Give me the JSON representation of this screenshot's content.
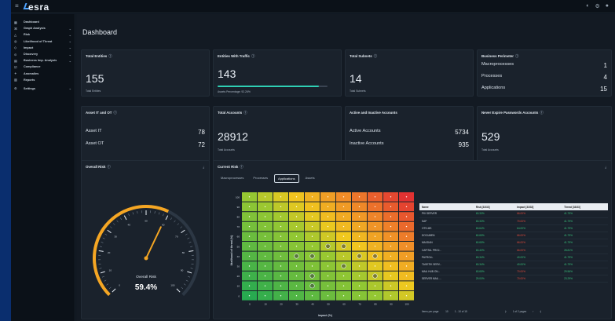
{
  "app": {
    "logo": "esra",
    "menu_icon": "menu-icon",
    "top_icons": [
      "notification-icon",
      "settings-icon",
      "user-icon"
    ]
  },
  "sidebar": {
    "items": [
      {
        "label": "Dashboard",
        "icon": "dashboard-icon",
        "chev": false
      },
      {
        "label": "Graph Analysis",
        "icon": "graph-icon",
        "chev": true
      },
      {
        "label": "Risk",
        "icon": "risk-icon",
        "chev": true
      },
      {
        "label": "Likelihood of Threat",
        "icon": "threat-icon",
        "chev": true
      },
      {
        "label": "Impact",
        "icon": "impact-icon",
        "chev": true
      },
      {
        "label": "Discovery",
        "icon": "discovery-icon",
        "chev": true
      },
      {
        "label": "Business Imp. Analysis",
        "icon": "business-icon",
        "chev": true
      },
      {
        "label": "Compliance",
        "icon": "compliance-icon",
        "chev": false
      },
      {
        "label": "Anomalies",
        "icon": "anomalies-icon",
        "chev": false
      },
      {
        "label": "Reports",
        "icon": "reports-icon",
        "chev": false
      },
      {
        "label": "Settings",
        "icon": "settings-icon",
        "chev": true
      }
    ]
  },
  "page_title": "Dashboard",
  "cards": {
    "total_entities": {
      "title": "Total Entities",
      "value": "155",
      "sub": "Total Entities"
    },
    "entities_traffic": {
      "title": "Entities With Traffic",
      "value": "143",
      "sub": "Assets Percentage: 92.26%",
      "progress": 0.9226
    },
    "total_subnets": {
      "title": "Total Subnets",
      "value": "14",
      "sub": "Total Subnets"
    },
    "business_perimeter": {
      "title": "Business Perimeter",
      "rows": [
        {
          "label": "Macroprocesses",
          "value": "1"
        },
        {
          "label": "Processes",
          "value": "4"
        },
        {
          "label": "Applications",
          "value": "15"
        }
      ]
    },
    "asset_it_ot": {
      "title": "Asset IT and OT",
      "rows": [
        {
          "label": "Asset IT",
          "value": "78"
        },
        {
          "label": "Asset OT",
          "value": "72"
        }
      ]
    },
    "total_accounts": {
      "title": "Total Accounts",
      "value": "28912",
      "sub": "Total Accounts"
    },
    "active_inactive": {
      "title": "Active and Inactive Accounts",
      "rows": [
        {
          "label": "Active Accounts",
          "value": "5734"
        },
        {
          "label": "Inactive Accounts",
          "value": "935"
        }
      ]
    },
    "never_expire": {
      "title": "Never Expire Passwords Accounts",
      "value": "529",
      "sub": "Total Accounts"
    }
  },
  "overall_risk": {
    "title": "Overall Risk",
    "label": "Overall Risk",
    "value": "59.4%",
    "level": 0.594,
    "ticks": [
      "0",
      "10",
      "20",
      "30",
      "40",
      "50",
      "60",
      "70",
      "80",
      "90",
      "100"
    ]
  },
  "current_risk": {
    "title": "Current Risk",
    "tabs": [
      "Macroprocesses",
      "Processes",
      "Applications",
      "Assets"
    ],
    "active_tab": "Applications",
    "ylabel": "likelihood of threat (%)",
    "xlabel": "impact (%)",
    "axis_ticks": [
      "0",
      "10",
      "20",
      "30",
      "40",
      "50",
      "60",
      "70",
      "80",
      "90",
      "100"
    ],
    "table": {
      "headers": [
        "Name",
        "Risk [33/33]",
        "Impact [33/33]",
        "Threat [33/33]"
      ],
      "rows": [
        [
          "PKI SERVER",
          "63.33%",
          "66.00%",
          "41.79%"
        ],
        [
          "SAP",
          "63.33%",
          "70.00%",
          "41.79%"
        ],
        [
          "OTS-MS",
          "63.64%",
          "64.00%",
          "41.79%"
        ],
        [
          "DOCUMEN",
          "60.65%",
          "66.00%",
          "41.79%"
        ],
        [
          "MAXDAN",
          "60.65%",
          "66.00%",
          "41.79%"
        ],
        [
          "CAPITAL PROJ...",
          "63.40%",
          "66.00%",
          "28.81%"
        ],
        [
          "PAYROLL",
          "63.34%",
          "40.00%",
          "41.79%"
        ],
        [
          "TAGETIK SERV...",
          "63.34%",
          "40.00%",
          "41.79%"
        ],
        [
          "MAIL HUB ON...",
          "63.65%",
          "70.00%",
          "29.56%"
        ],
        [
          "SERVER MAIL ...",
          "29.00%",
          "70.00%",
          "23.29%"
        ]
      ],
      "items_per_page_label": "Items per page:",
      "items_per_page": "10",
      "range": "1 - 10 of 15",
      "pages": "1 of 2 pages"
    }
  },
  "colors": {
    "accent": "#2fd0b4",
    "gauge": "#f5a623",
    "low": "#27ae60",
    "mid": "#f1c40f",
    "high": "#e74c3c"
  }
}
